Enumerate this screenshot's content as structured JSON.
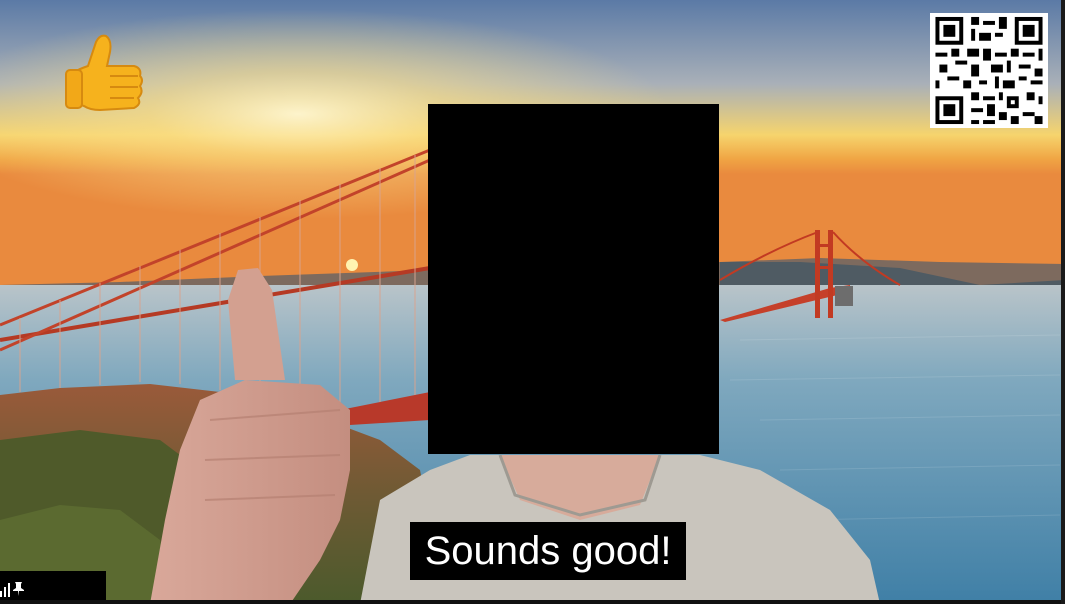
{
  "caption": {
    "text": "Sounds good!"
  },
  "reaction": {
    "icon": "thumbs-up-emoji-icon",
    "color": "#f6b21d"
  },
  "overlay": {
    "qr_icon": "qr-code-icon"
  },
  "video_tile": {
    "status_icons": [
      "signal-strength-icon",
      "pin-icon"
    ],
    "redaction_color": "#000000"
  },
  "colors": {
    "sky_top": "#5d7ba8",
    "sunset": "#f7c24e",
    "bridge": "#c23a22",
    "sea": "#6a9cb6"
  }
}
